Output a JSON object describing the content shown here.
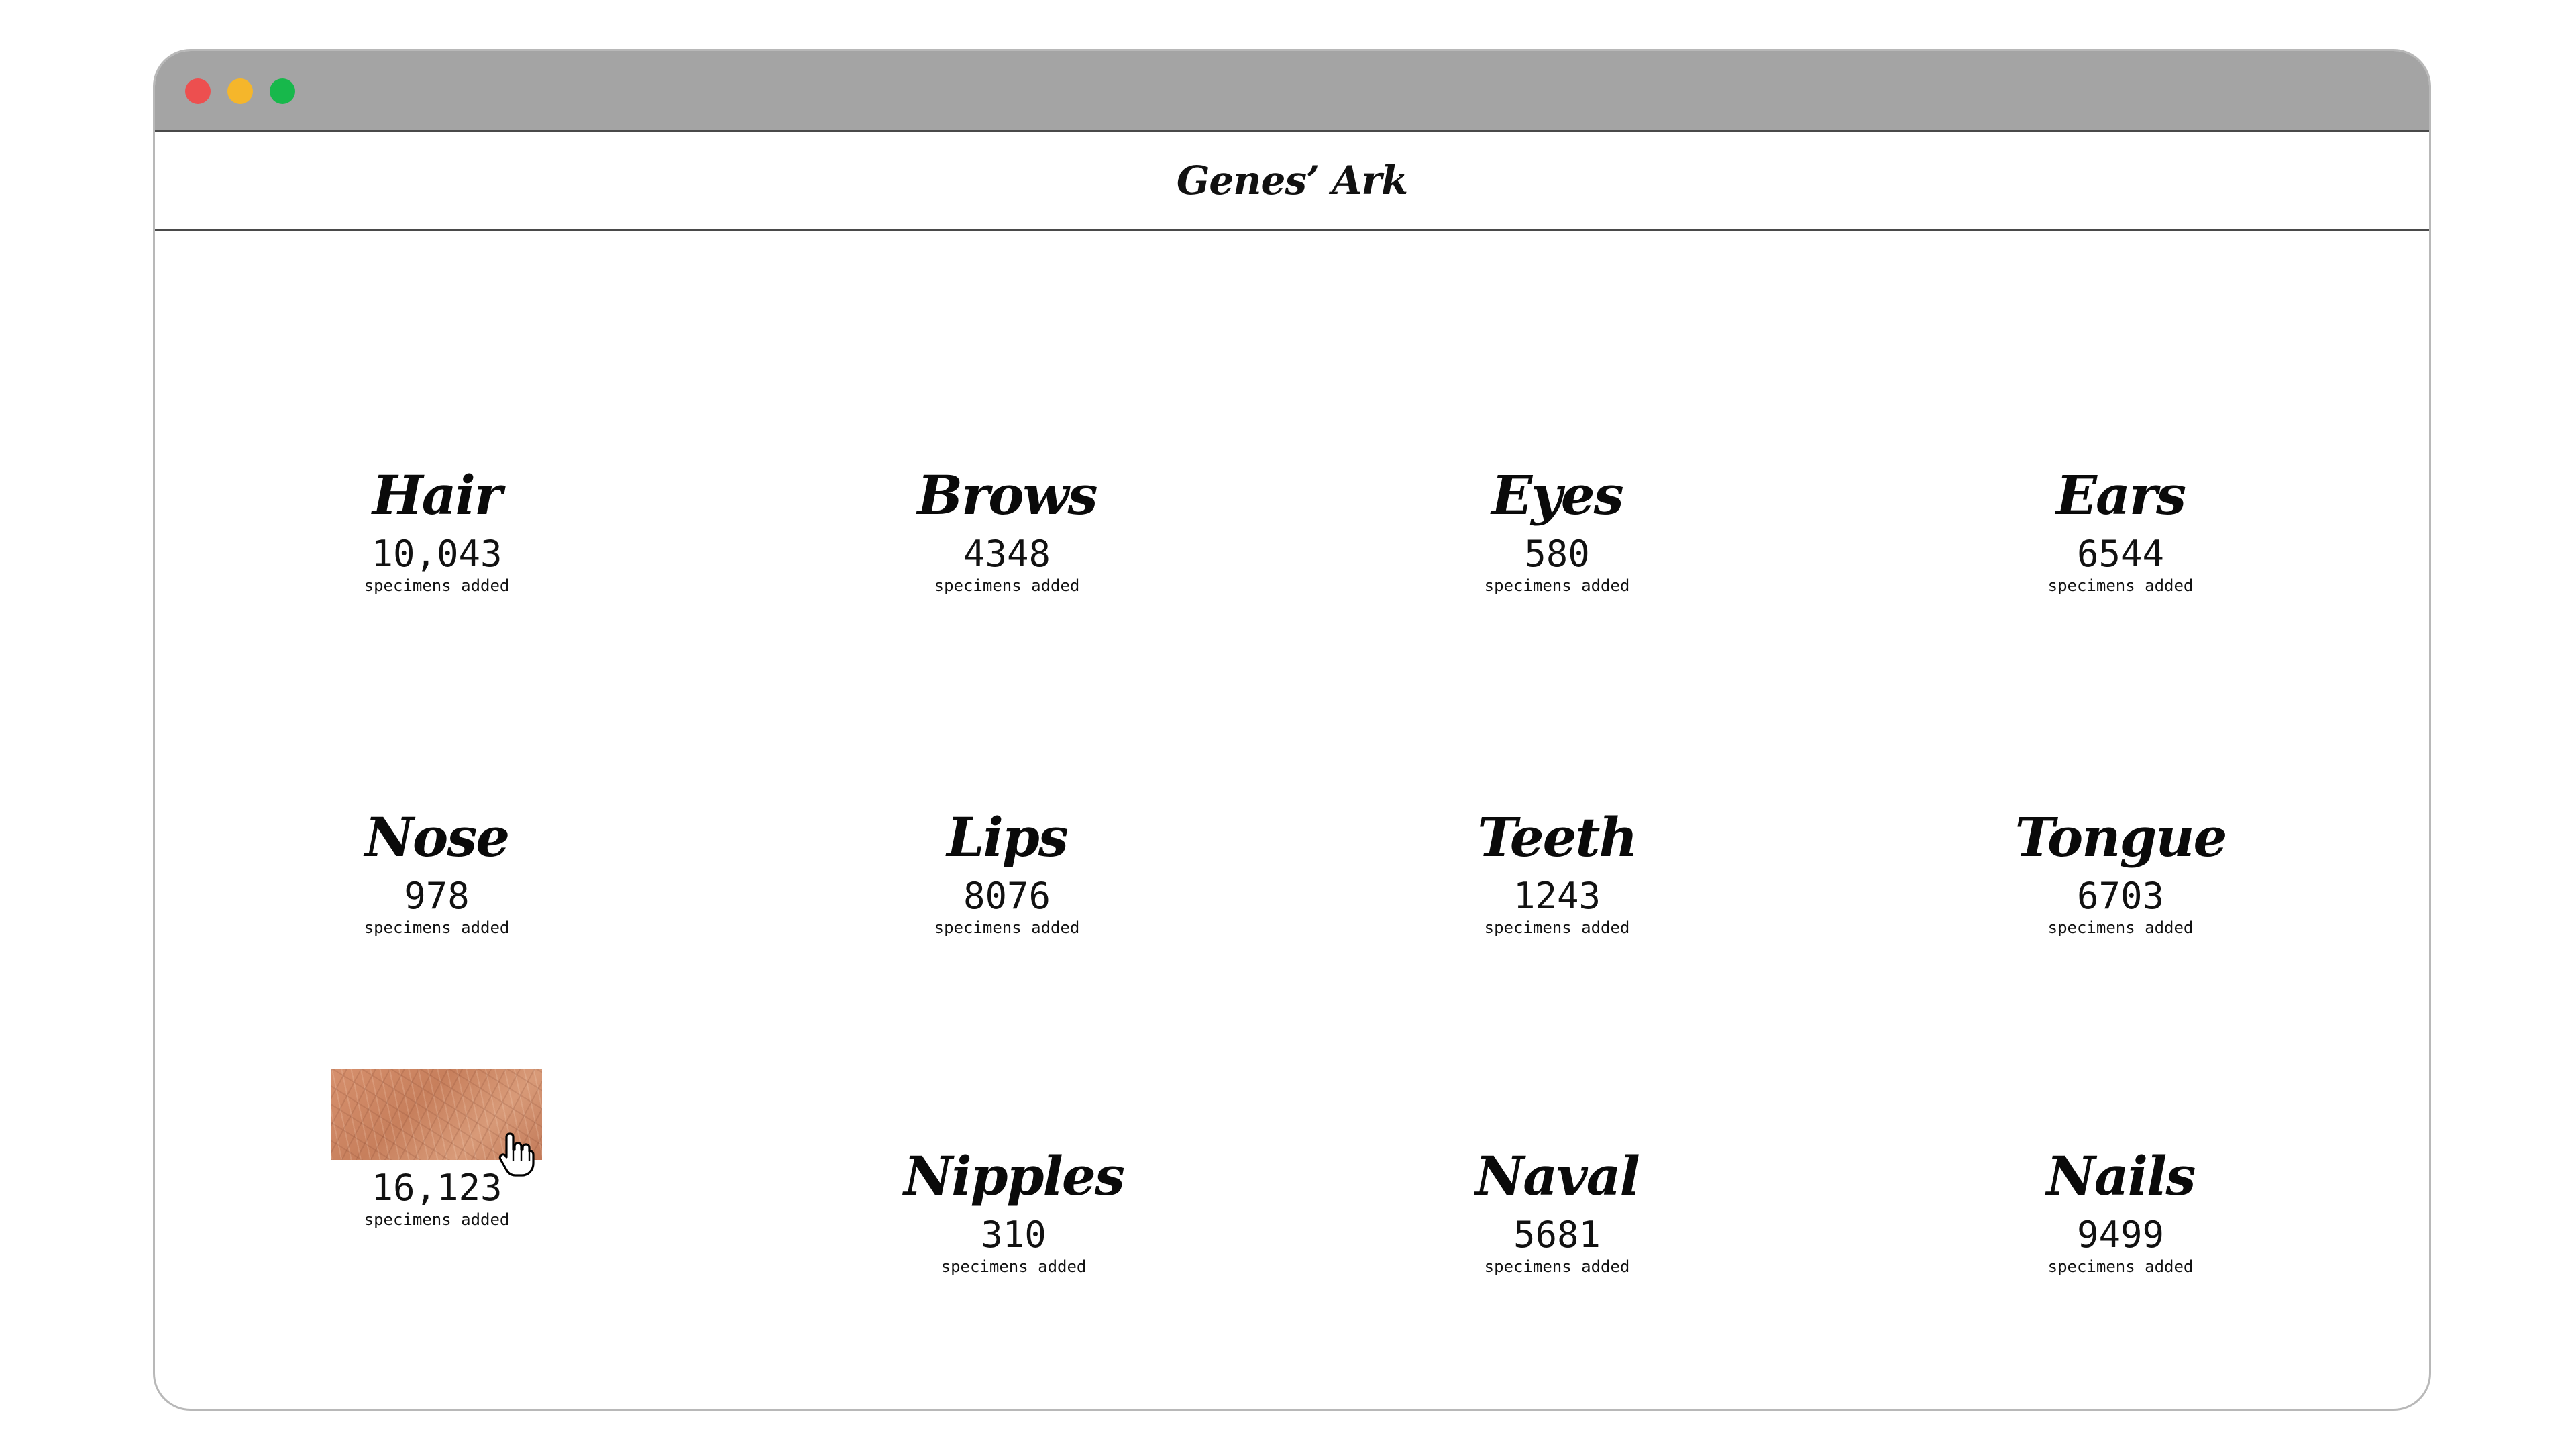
{
  "window": {
    "controls": [
      {
        "name": "close",
        "color": "#ed4f4f"
      },
      {
        "name": "minimize",
        "color": "#f5b62b"
      },
      {
        "name": "maximize",
        "color": "#17b84b"
      }
    ]
  },
  "header": {
    "title": "Genes’ Ark"
  },
  "caption_text": "specimens added",
  "categories": [
    {
      "name": "Hair",
      "count": "10,043",
      "caption": "specimens added"
    },
    {
      "name": "Brows",
      "count": "4348",
      "caption": "specimens added"
    },
    {
      "name": "Eyes",
      "count": "580",
      "caption": "specimens added"
    },
    {
      "name": "Ears",
      "count": "6544",
      "caption": "specimens added"
    },
    {
      "name": "Nose",
      "count": "978",
      "caption": "specimens added"
    },
    {
      "name": "Lips",
      "count": "8076",
      "caption": "specimens added"
    },
    {
      "name": "Teeth",
      "count": "1243",
      "caption": "specimens added"
    },
    {
      "name": "Tongue",
      "count": "6703",
      "caption": "specimens added"
    },
    {
      "name": "",
      "count": "16,123",
      "caption": "specimens added",
      "thumbnail": "skin-texture-image",
      "hovered": true
    },
    {
      "name": "Nipples",
      "count": "310",
      "caption": "specimens added"
    },
    {
      "name": "Naval",
      "count": "5681",
      "caption": "specimens added"
    },
    {
      "name": "Nails",
      "count": "9499",
      "caption": "specimens added"
    }
  ],
  "cursor": {
    "icon": "hand-pointer-icon"
  }
}
